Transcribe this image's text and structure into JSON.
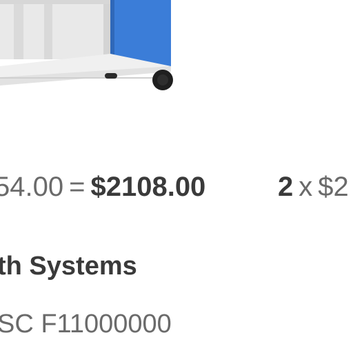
{
  "product": {
    "image_icon": "mobile-shelf-cart-icon",
    "accent_color": "#3b7dd8"
  },
  "pricing": {
    "row1": {
      "unit_price": "54.00",
      "equals": "=",
      "total": "$2108.00"
    },
    "row2": {
      "qty": "2",
      "times": "x",
      "unit_price_start": "$2"
    }
  },
  "vendor": {
    "name": "th Systems"
  },
  "sku": {
    "code": "SC F11000000"
  }
}
